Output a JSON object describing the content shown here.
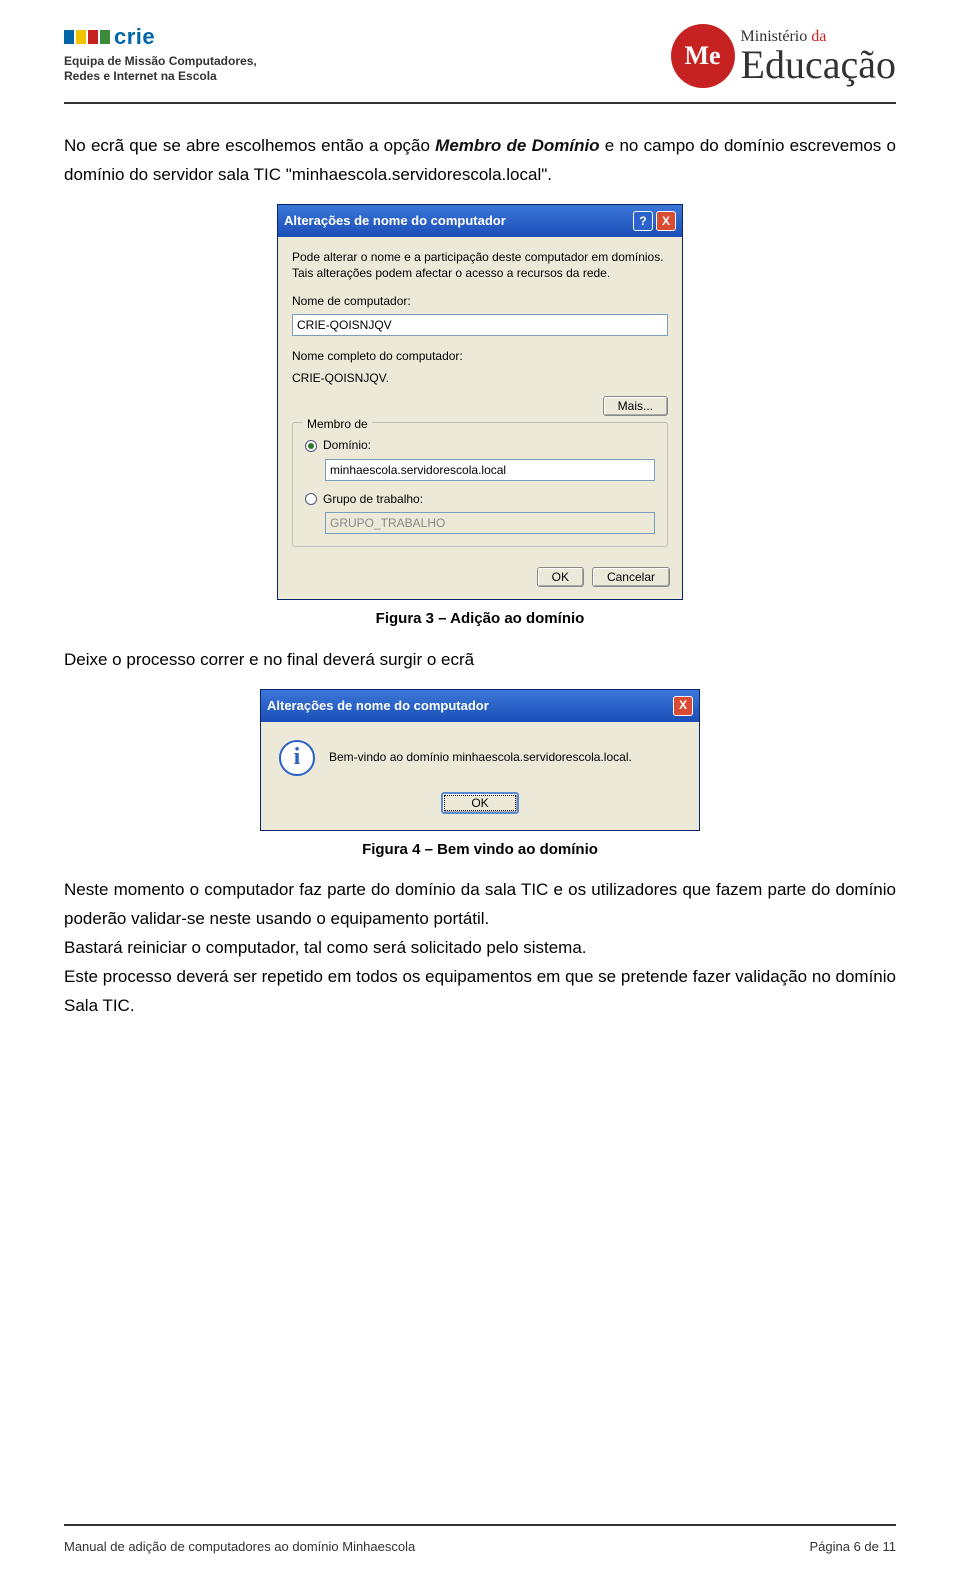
{
  "header": {
    "logo_left_title": "crie",
    "logo_left_sub1": "Equipa de Missão Computadores,",
    "logo_left_sub2": "Redes e Internet na Escola",
    "me_badge": "Me",
    "min_line1_a": "Ministério",
    "min_line1_b": " da",
    "min_line2": "Educação"
  },
  "body": {
    "para1_a": "No ecrã que se abre escolhemos então a opção ",
    "para1_b": "Membro de Domínio",
    "para1_c": " e no campo do domínio escrevemos o domínio do servidor sala TIC \"minhaescola.servidorescola.local\".",
    "caption1": "Figura 3 – Adição ao domínio",
    "para2": "Deixe o processo correr e no final deverá surgir o ecrã",
    "caption2": "Figura 4 – Bem vindo ao domínio",
    "para3": "Neste momento o computador faz parte do domínio da sala TIC e os utilizadores que fazem parte do domínio poderão validar-se neste usando o equipamento portátil.",
    "para4": "Bastará reiniciar o computador, tal como será solicitado pelo sistema.",
    "para5": "Este processo deverá ser repetido em todos os equipamentos em que se pretende fazer validação no domínio Sala TIC."
  },
  "dialog1": {
    "title": "Alterações de nome do computador",
    "help": "?",
    "close": "X",
    "desc": "Pode alterar o nome e a participação deste computador em domínios. Tais alterações podem afectar o acesso a recursos da rede.",
    "label_name": "Nome de computador:",
    "value_name": "CRIE-QOISNJQV",
    "label_full": "Nome completo do computador:",
    "value_full": "CRIE-QOISNJQV.",
    "btn_more": "Mais...",
    "group_title": "Membro de",
    "radio_domain": "Domínio:",
    "value_domain": "minhaescola.servidorescola.local",
    "radio_workgroup": "Grupo de trabalho:",
    "value_workgroup": "GRUPO_TRABALHO",
    "btn_ok": "OK",
    "btn_cancel": "Cancelar"
  },
  "dialog2": {
    "title": "Alterações de nome do computador",
    "close": "X",
    "icon": "i",
    "message": "Bem-vindo ao domínio minhaescola.servidorescola.local.",
    "btn_ok": "OK"
  },
  "footer": {
    "left": "Manual de adição de computadores ao domínio Minhaescola",
    "right": "Página 6 de 11"
  }
}
